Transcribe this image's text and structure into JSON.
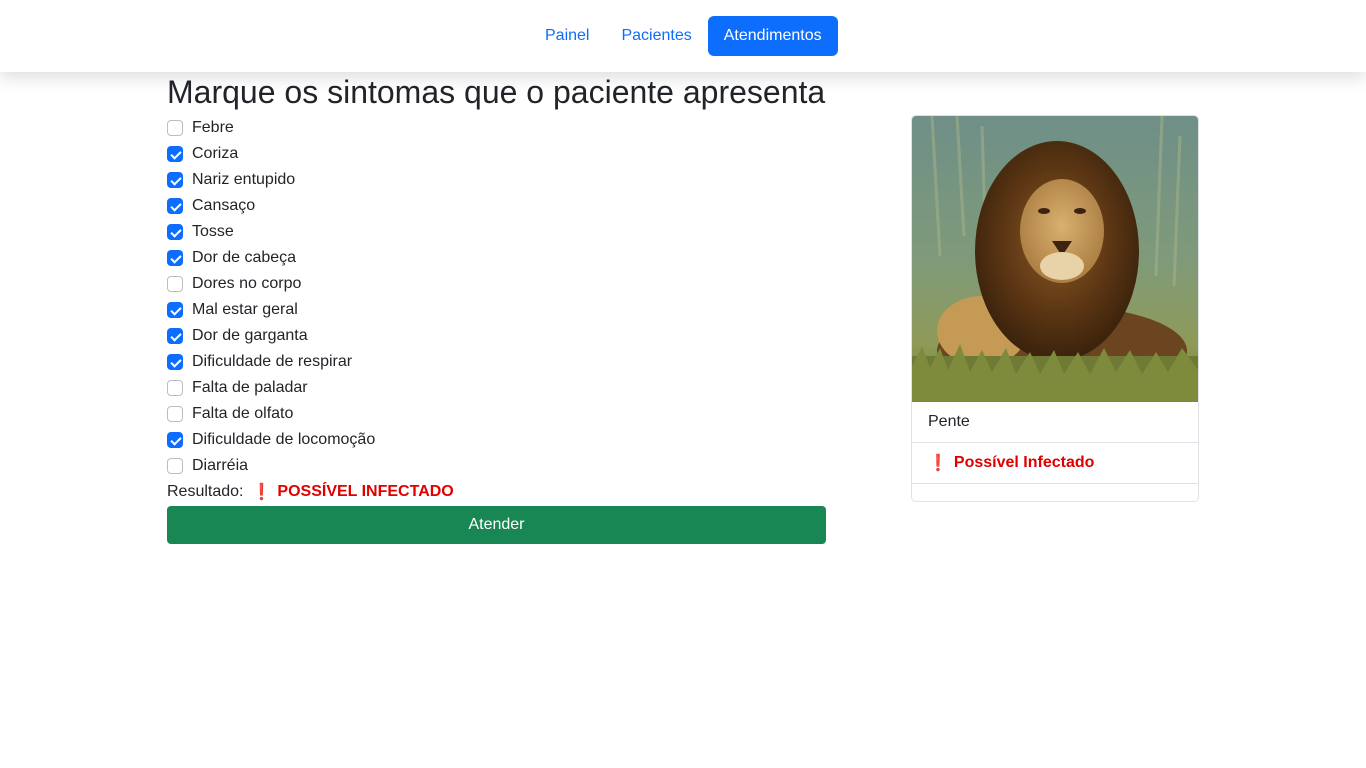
{
  "nav": {
    "items": [
      {
        "label": "Painel",
        "active": false
      },
      {
        "label": "Pacientes",
        "active": false
      },
      {
        "label": "Atendimentos",
        "active": true
      }
    ]
  },
  "main": {
    "title": "Marque os sintomas que o paciente apresenta",
    "symptoms": [
      {
        "label": "Febre",
        "checked": false
      },
      {
        "label": "Coriza",
        "checked": true
      },
      {
        "label": "Nariz entupido",
        "checked": true
      },
      {
        "label": "Cansaço",
        "checked": true
      },
      {
        "label": "Tosse",
        "checked": true
      },
      {
        "label": "Dor de cabeça",
        "checked": true
      },
      {
        "label": "Dores no corpo",
        "checked": false
      },
      {
        "label": "Mal estar geral",
        "checked": true
      },
      {
        "label": "Dor de garganta",
        "checked": true
      },
      {
        "label": "Dificuldade de respirar",
        "checked": true
      },
      {
        "label": "Falta de paladar",
        "checked": false
      },
      {
        "label": "Falta de olfato",
        "checked": false
      },
      {
        "label": "Dificuldade de locomoção",
        "checked": true
      },
      {
        "label": "Diarréia",
        "checked": false
      }
    ],
    "result_label": "Resultado:",
    "result_icon": "❗",
    "result_value": "POSSÍVEL INFECTADO",
    "submit_label": "Atender"
  },
  "patient_card": {
    "name": "Pente",
    "status_icon": "❗",
    "status": "Possível Infectado",
    "photo": "lion-photo"
  },
  "colors": {
    "primary": "#0d6efd",
    "success": "#198754",
    "danger": "#e00000"
  }
}
